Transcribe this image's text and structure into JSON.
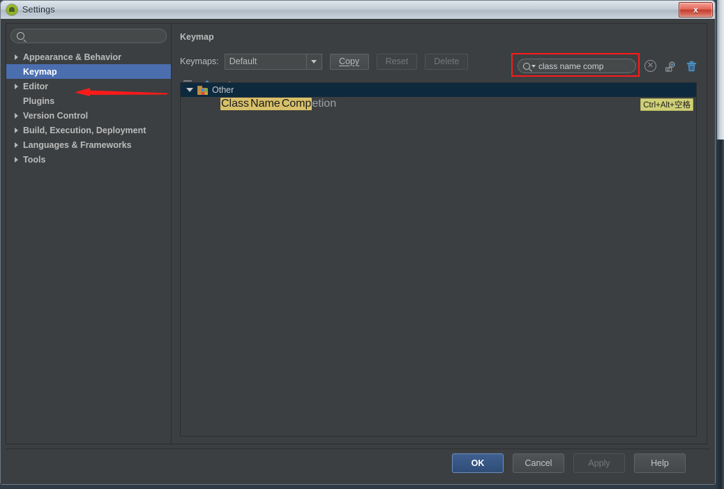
{
  "window": {
    "title": "Settings",
    "app_icon": "android-studio-icon",
    "close_label": "x"
  },
  "sidebar": {
    "search": {
      "value": "",
      "placeholder": "",
      "icon": "search-icon"
    },
    "items": [
      {
        "label": "Appearance & Behavior",
        "expandable": true,
        "selected": false
      },
      {
        "label": "Keymap",
        "expandable": false,
        "selected": true
      },
      {
        "label": "Editor",
        "expandable": true,
        "selected": false
      },
      {
        "label": "Plugins",
        "expandable": false,
        "selected": false
      },
      {
        "label": "Version Control",
        "expandable": true,
        "selected": false
      },
      {
        "label": "Build, Execution, Deployment",
        "expandable": true,
        "selected": false
      },
      {
        "label": "Languages & Frameworks",
        "expandable": true,
        "selected": false
      },
      {
        "label": "Tools",
        "expandable": true,
        "selected": false
      }
    ],
    "annotation": {
      "type": "red-arrow",
      "points_to": "Keymap"
    }
  },
  "main": {
    "title": "Keymap",
    "keymaps_label": "Keymaps:",
    "keymap_selected": "Default",
    "buttons": [
      {
        "label": "Copy",
        "mnemonic": "C",
        "disabled": false
      },
      {
        "label": "Reset",
        "disabled": true
      },
      {
        "label": "Delete",
        "disabled": true
      }
    ],
    "toolbar_icons": [
      "expand-all-icon",
      "collapse-all-icon",
      "edit-shortcut-icon"
    ],
    "action_search": {
      "value": "class name comp",
      "icon": "search-dropdown-icon",
      "clear_icon": "clear-icon",
      "find_by_shortcut_icon": "find-by-shortcut-icon",
      "clear_all_icon": "trash-icon",
      "highlighted": true,
      "highlight_color": "#ff1a1a"
    },
    "tree": {
      "group": {
        "label": "Other",
        "expanded": true,
        "icon": "plugin-folder-icon",
        "selected": true
      },
      "rows": [
        {
          "segments": [
            {
              "text": "Class",
              "match": true
            },
            {
              "text": "Name",
              "match": true
            },
            {
              "text": "Comp",
              "match": true
            },
            {
              "text": "etion",
              "match": false
            }
          ],
          "shortcut": "Ctrl+Alt+空格"
        }
      ]
    }
  },
  "footer": {
    "buttons": [
      {
        "label": "OK",
        "primary": true,
        "disabled": false
      },
      {
        "label": "Cancel",
        "primary": false,
        "disabled": false
      },
      {
        "label": "Apply",
        "primary": false,
        "disabled": true
      },
      {
        "label": "Help",
        "primary": false,
        "disabled": false
      }
    ]
  },
  "colors": {
    "selection_blue": "#4b6eaf",
    "tree_selection": "#0d293e",
    "match_highlight": "#d8c06a",
    "shortcut_badge": "#cfcf77",
    "annotation_red": "#ff1a1a",
    "panel_bg": "#3c3f41"
  }
}
